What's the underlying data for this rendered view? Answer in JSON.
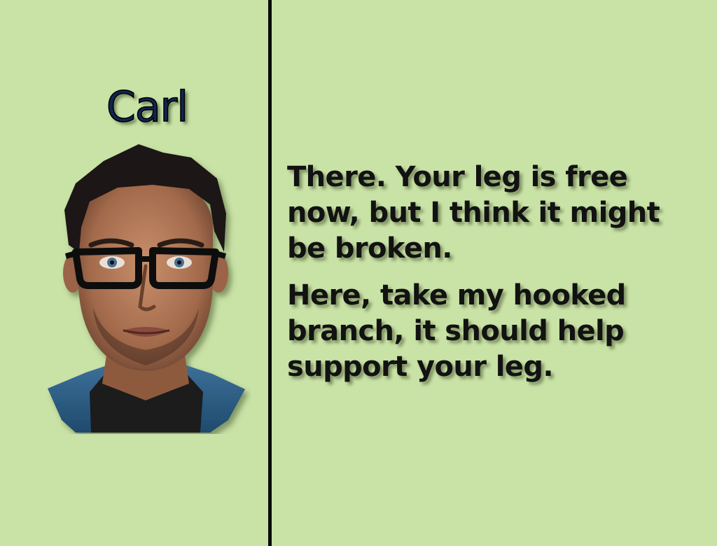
{
  "speaker": {
    "name": "Carl"
  },
  "dialog": {
    "lines": [
      "There. Your leg is free now, but I think it might be broken.",
      "Here, take my hooked branch, it should help support your leg."
    ]
  },
  "colors": {
    "background": "#c9e2a6",
    "divider": "#0a0a0a",
    "name_text": "#0e2652",
    "dialog_text": "#121212"
  },
  "icons": {
    "portrait": "carl-portrait-icon"
  }
}
